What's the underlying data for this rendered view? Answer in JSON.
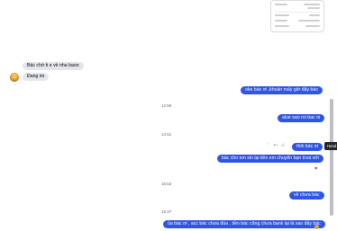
{
  "conversation": {
    "messages": [
      {
        "id": "m1",
        "direction": "in",
        "text": "Bác chờ ti e về nha baoo"
      },
      {
        "id": "m2",
        "direction": "in",
        "text": "Đang im"
      },
      {
        "id": "m3",
        "direction": "out",
        "text": "oke bác ơi ,khoản mấy giờ đấy bác"
      },
      {
        "id": "t1",
        "type": "time",
        "text": "12:56"
      },
      {
        "id": "m4",
        "direction": "out",
        "text": "alue sao roi bac oi"
      },
      {
        "id": "t2",
        "type": "time",
        "text": "14:51"
      },
      {
        "id": "m5",
        "direction": "out",
        "text": "thôi bác ơi"
      },
      {
        "id": "m6",
        "direction": "out",
        "text": "bác cho em xin lại tiền em chuyển bạn trưa với"
      },
      {
        "id": "t3",
        "type": "time",
        "text": "15:53"
      },
      {
        "id": "m7",
        "direction": "out",
        "text": "về chưa bác"
      },
      {
        "id": "t4",
        "type": "time",
        "text": "16:37"
      },
      {
        "id": "m8",
        "direction": "out",
        "text": "ủa bác ơi , acc bác chưa đúa , tiền bác cũng chưa bank lại là sao đấy bác"
      }
    ],
    "hover_actions": {
      "more": "⋮",
      "reply": "↩",
      "react": "☺"
    },
    "tooltip": "Head",
    "reaction": "♥",
    "colors": {
      "outgoing": "#2f55e6",
      "incoming": "#e4e6eb",
      "time": "#65676b"
    }
  }
}
